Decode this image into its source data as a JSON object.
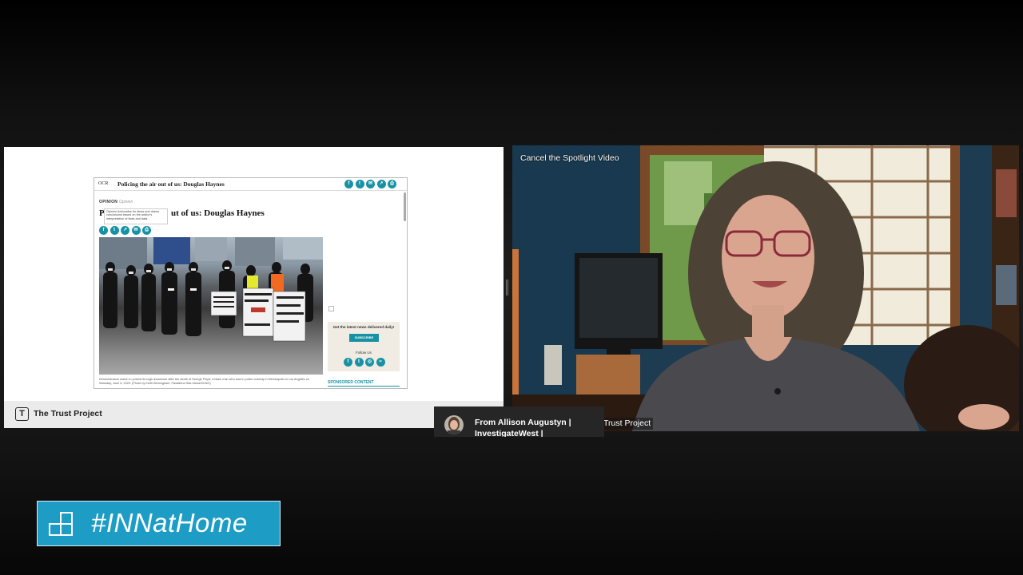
{
  "shared_screen": {
    "article": {
      "logo": "OCR",
      "top_title": "Policing the air out of us: Douglas Haynes",
      "kicker": "OPINION",
      "kicker_sub": "Opinion",
      "tooltip": "Opinion Advocates for ideas and draws conclusions based on the author's interpretation of facts and data.",
      "headline_initial": "P",
      "headline_rest": "ut of us: Douglas Haynes",
      "photo_signs": [
        "BLACK LIVES MATTER",
        "BLACK LIVES MATTER",
        "AM I NEXT? MY COLOR IS NOT A WEAPON",
        "STOP KNOCKING DOWN THE YOUNG SO THEY FEEL TALL"
      ],
      "caption": "Demonstrators march in protest through downtown after the death of George Floyd, a black man who was in police custody in Minneapolis in Los Angeles on Saturday, June 6, 2020. (Photo by Keith Birmingham, Pasadena Star-News/SCNG)",
      "sidebox_title": "Get the latest news delivered daily!",
      "subscribe_label": "SUBSCRIBE",
      "follow_label": "Follow Us",
      "sponsored_label": "SPONSORED CONTENT",
      "top_social_icons": [
        "facebook-icon",
        "twitter-icon",
        "email-icon",
        "share-icon",
        "print-icon"
      ],
      "inline_social_icons": [
        "facebook-icon",
        "twitter-icon",
        "share-icon",
        "email-icon",
        "print-icon"
      ],
      "follow_icons": [
        "facebook-icon",
        "twitter-icon",
        "instagram-icon",
        "rss-icon"
      ]
    },
    "trust_bar_label": "The Trust Project",
    "trust_icon_glyph": "T"
  },
  "video": {
    "spotlight_label": "Cancel the Spotlight Video",
    "participant_label": "Trust Project"
  },
  "chat_toast": {
    "text": "From Allison Augustyn | InvestigateWest |"
  },
  "hashtag": {
    "text": "#INNatHome"
  },
  "colors": {
    "accent_teal": "#1692a4",
    "banner_blue": "#1d9dc6"
  }
}
